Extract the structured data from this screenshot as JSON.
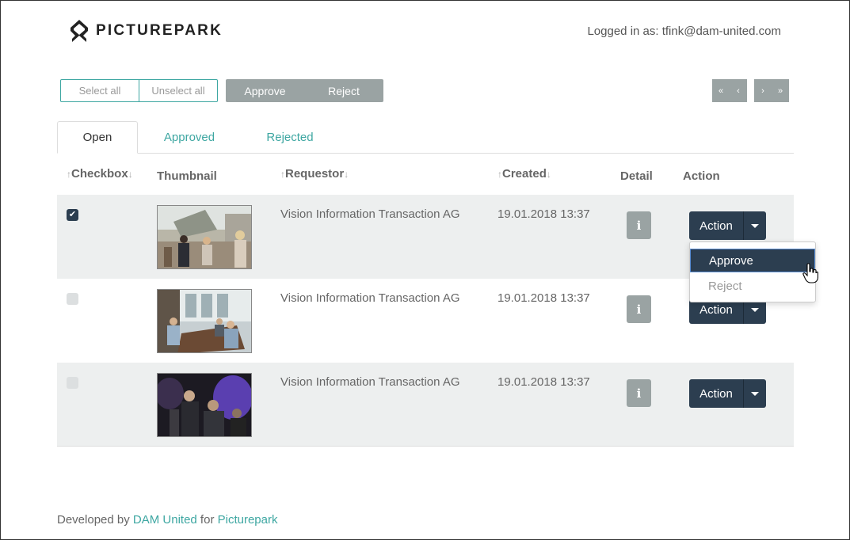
{
  "brand": {
    "name": "PICTUREPARK",
    "logo_icon": "picturepark-logo-icon"
  },
  "header": {
    "logged_in": "Logged in as: tfink@dam-united.com"
  },
  "toolbar": {
    "select_all": "Select all",
    "unselect_all": "Unselect all",
    "approve": "Approve",
    "reject": "Reject"
  },
  "pager": {
    "first": "«",
    "prev": "‹",
    "next": "›",
    "last": "»"
  },
  "tabs": [
    "Open",
    "Approved",
    "Rejected"
  ],
  "table": {
    "headers": {
      "checkbox": "Checkbox",
      "thumbnail": "Thumbnail",
      "requestor": "Requestor",
      "created": "Created",
      "detail": "Detail",
      "action": "Action"
    },
    "sort_up": "↑",
    "sort_down": "↓",
    "rows": [
      {
        "checked": true,
        "requestor": "Vision Information Transaction AG",
        "created": "19.01.2018 13:37",
        "detail_icon": "i",
        "action": "Action"
      },
      {
        "checked": false,
        "requestor": "Vision Information Transaction AG",
        "created": "19.01.2018 13:37",
        "detail_icon": "i",
        "action": "Action"
      },
      {
        "checked": false,
        "requestor": "Vision Information Transaction AG",
        "created": "19.01.2018 13:37",
        "detail_icon": "i",
        "action": "Action"
      }
    ]
  },
  "dropdown": {
    "approve": "Approve",
    "reject": "Reject"
  },
  "footer": {
    "prefix": "Developed by ",
    "dam": "DAM United",
    "for": " for ",
    "picturepark": "Picturepark"
  },
  "colors": {
    "accent": "#3ea7a2",
    "dark": "#2c3e50",
    "grey": "#9aa3a3"
  }
}
